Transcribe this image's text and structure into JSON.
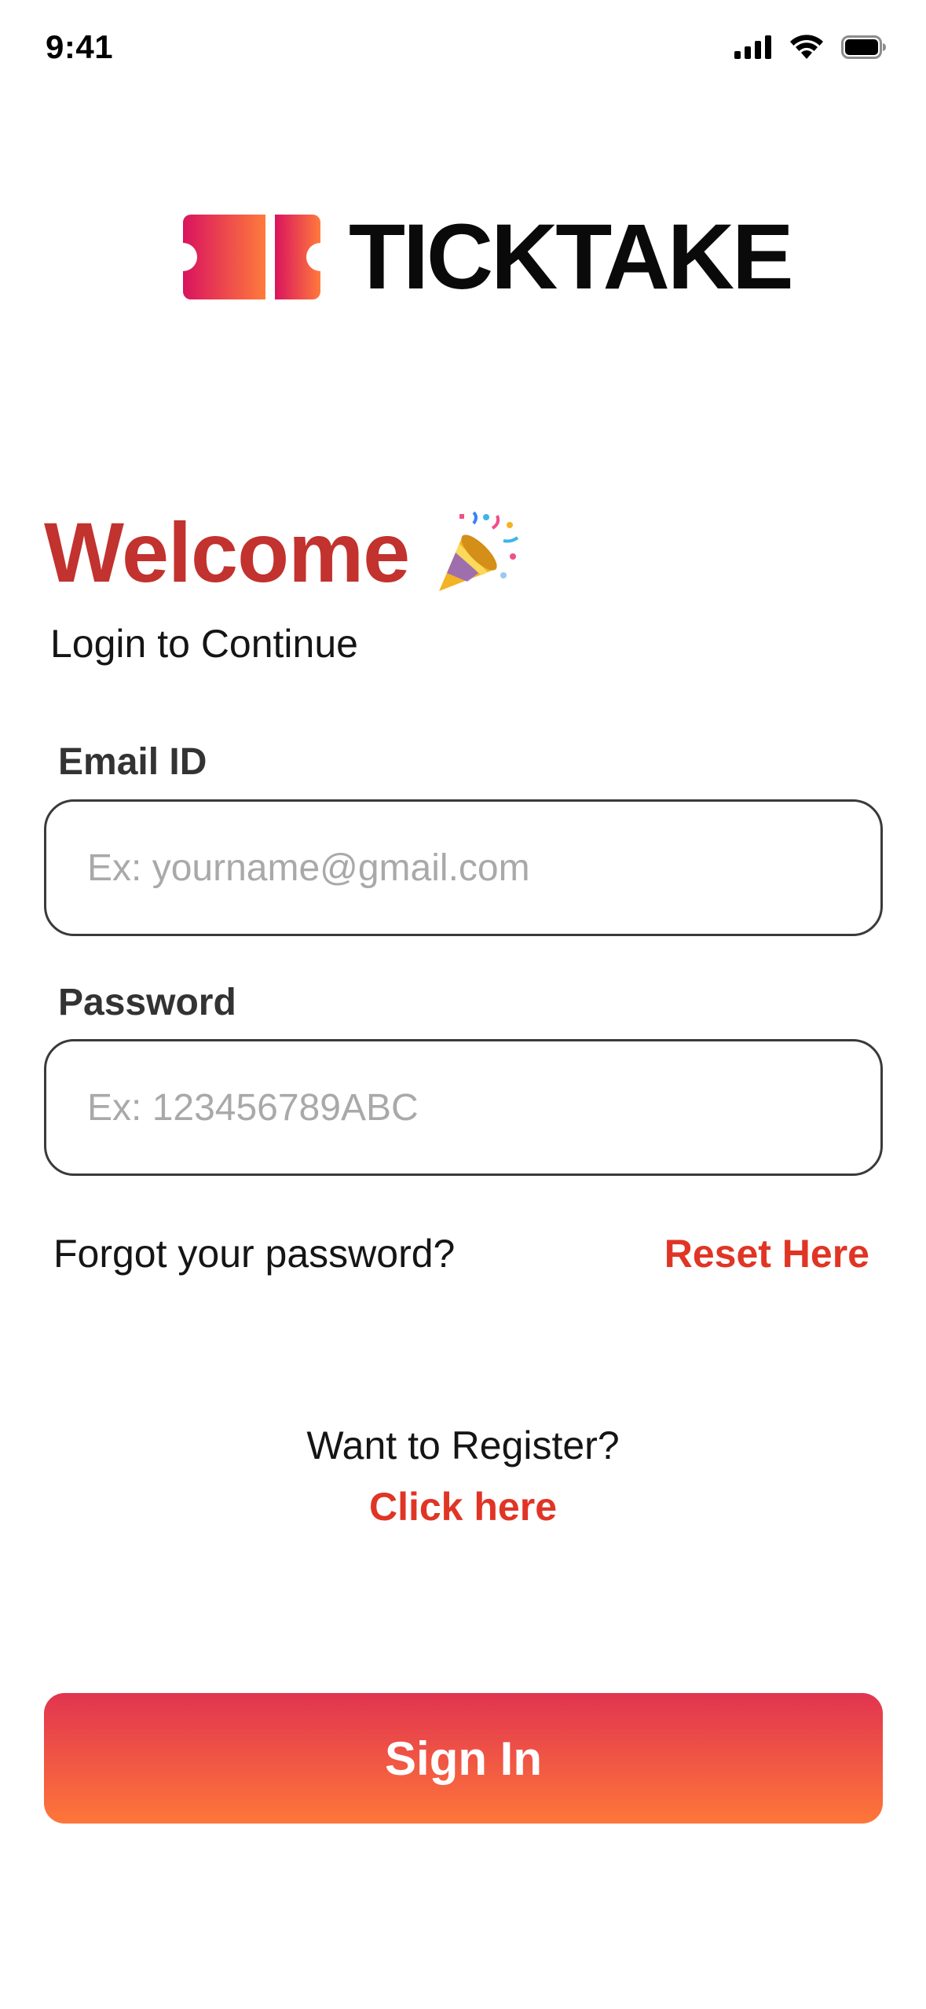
{
  "status_bar": {
    "time": "9:41",
    "icons": [
      "cellular-signal-icon",
      "wifi-icon",
      "battery-icon"
    ]
  },
  "brand": {
    "name": "TICKTAKE",
    "logo_icon": "ticket-icon",
    "gradient_colors": [
      "#d9145f",
      "#ff7a3c"
    ]
  },
  "welcome": {
    "title": "Welcome",
    "emoji_icon": "party-popper-icon",
    "subtitle": "Login to Continue"
  },
  "form": {
    "email": {
      "label": "Email ID",
      "placeholder": "Ex: yourname@gmail.com",
      "value": ""
    },
    "password": {
      "label": "Password",
      "placeholder": "Ex: 123456789ABC",
      "value": ""
    }
  },
  "forgot": {
    "text": "Forgot your password?",
    "link": "Reset Here"
  },
  "register": {
    "text": "Want to Register?",
    "link": "Click here"
  },
  "sign_in_label": "Sign In",
  "colors": {
    "accent": "#e03525",
    "title": "#c2322e",
    "button_gradient": [
      "#e1344f",
      "#fe763a"
    ]
  }
}
